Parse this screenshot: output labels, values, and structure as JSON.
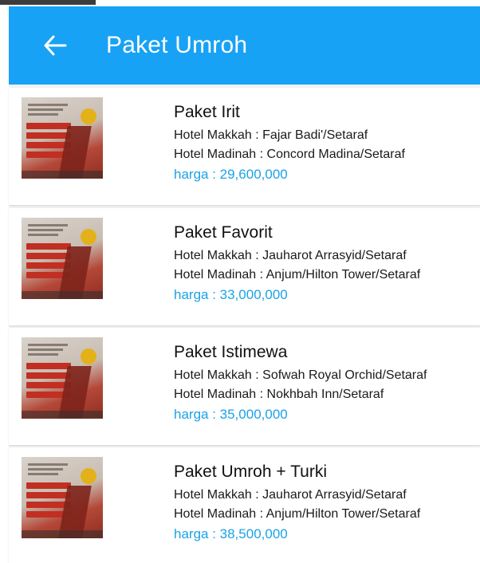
{
  "appbar": {
    "title": "Paket Umroh",
    "back_icon": "arrow-left-icon",
    "color": "#17a2f5"
  },
  "packages": [
    {
      "name": "Paket Irit",
      "hotel_makkah": "Hotel Makkah : Fajar Badi'/Setaraf",
      "hotel_madinah": "Hotel Madinah : Concord Madina/Setaraf",
      "price": "harga : 29,600,000",
      "image_icon": "umroh-brochure-image"
    },
    {
      "name": "Paket Favorit",
      "hotel_makkah": "Hotel Makkah : Jauharot Arrasyid/Setaraf",
      "hotel_madinah": "Hotel Madinah : Anjum/Hilton Tower/Setaraf",
      "price": "harga : 33,000,000",
      "image_icon": "umroh-brochure-image"
    },
    {
      "name": "Paket Istimewa",
      "hotel_makkah": "Hotel Makkah : Sofwah Royal Orchid/Setaraf",
      "hotel_madinah": "Hotel Madinah : Nokhbah Inn/Setaraf",
      "price": "harga : 35,000,000",
      "image_icon": "umroh-brochure-image"
    },
    {
      "name": "Paket Umroh + Turki",
      "hotel_makkah": "Hotel Makkah : Jauharot Arrasyid/Setaraf",
      "hotel_madinah": "Hotel Madinah : Anjum/Hilton Tower/Setaraf",
      "price": "harga : 38,500,000",
      "image_icon": "umroh-brochure-image"
    }
  ],
  "colors": {
    "price": "#1ba3e6",
    "list_background": "#f2f2f2"
  }
}
